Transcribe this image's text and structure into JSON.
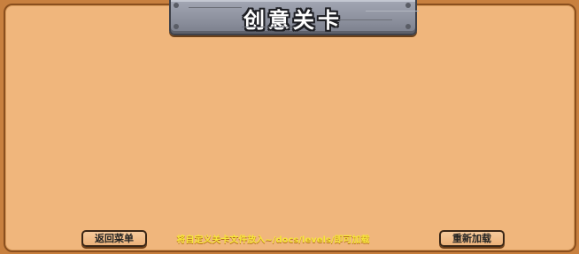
{
  "screen": {
    "title": "创意关卡"
  },
  "footer": {
    "back_label": "返回菜单",
    "hint": "将自定义关卡文件放入~/docs/levels/即可加载",
    "reload_label": "重新加载"
  },
  "colors": {
    "background": "#f0b67c",
    "border": "#c8803f",
    "hint_text": "#f7e63a",
    "title_plate": "#8e929f"
  }
}
